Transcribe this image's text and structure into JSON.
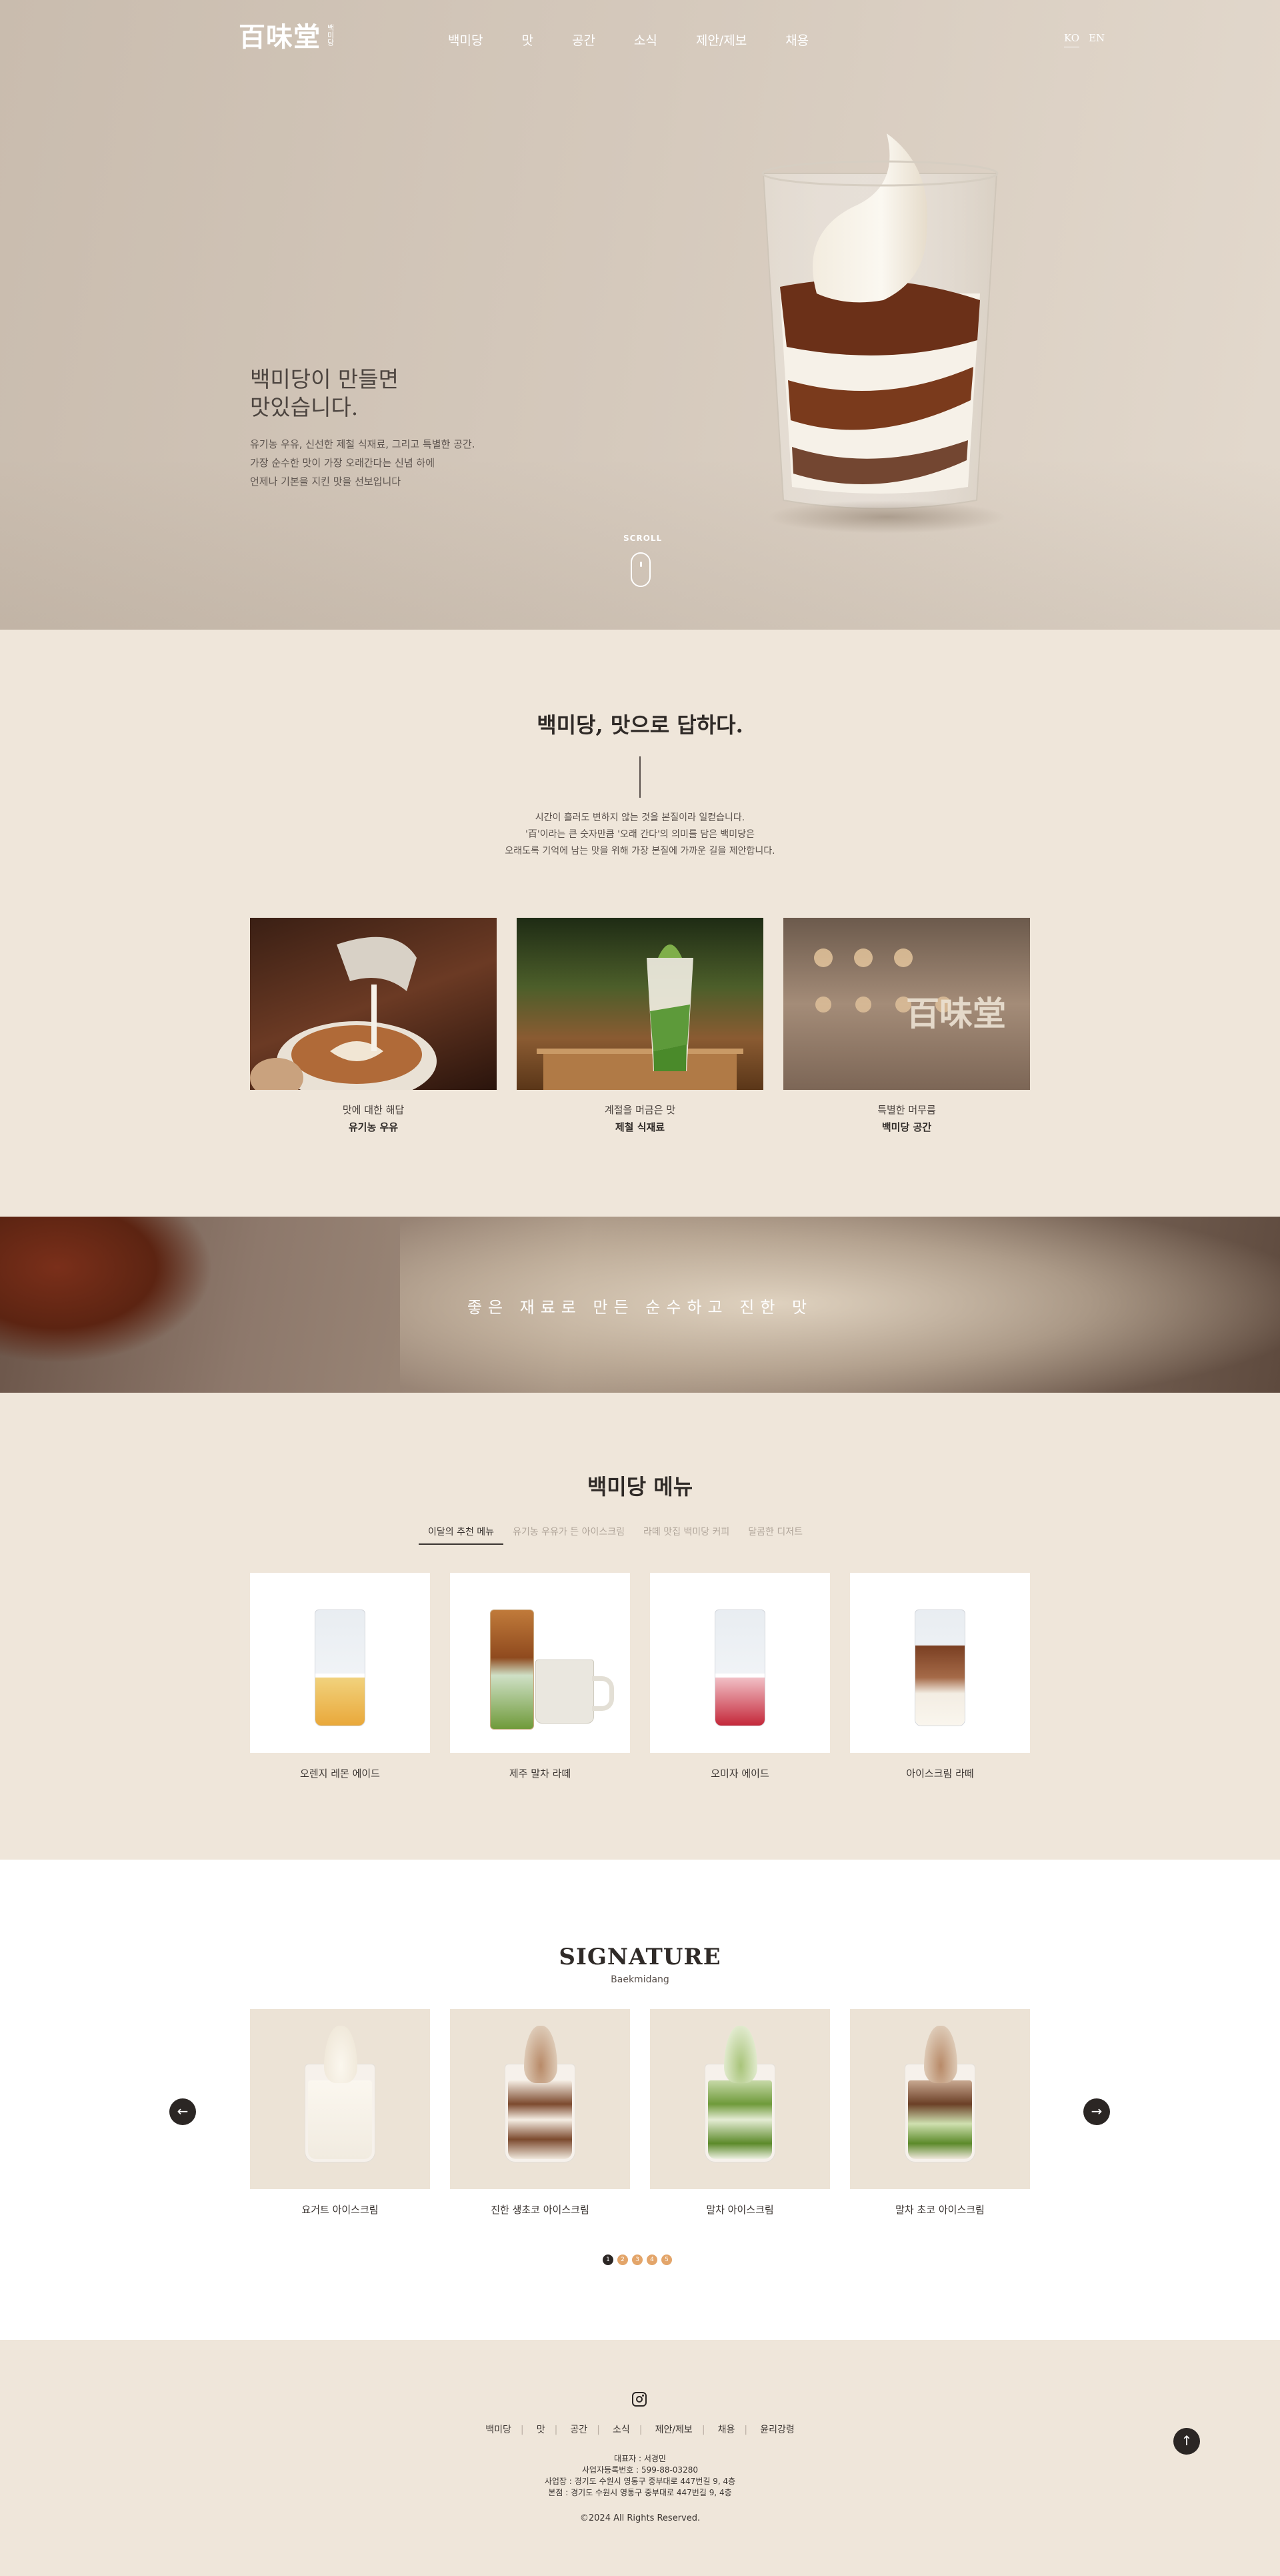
{
  "brand": {
    "logo_main": "百味堂",
    "logo_sub": "백미당"
  },
  "nav": {
    "items": [
      "백미당",
      "맛",
      "공간",
      "소식",
      "제안/제보",
      "채용"
    ],
    "languages": [
      "KO",
      "EN"
    ],
    "active_language": "KO"
  },
  "hero": {
    "title_line1": "백미당이 만들면",
    "title_line2": "맛있습니다.",
    "desc_lines": [
      "유기농 우유, 신선한 제철 식재료, 그리고 특별한 공간.",
      "가장 순수한 맛이 가장 오래간다는 신념 하에",
      "언제나 기본을 지킨 맛을 선보입니다"
    ],
    "scroll_label": "SCROLL"
  },
  "intro": {
    "title": "백미당, 맛으로 답하다.",
    "lines": [
      "시간이 흘러도 변하지 않는 것을 본질이라 일컫습니다.",
      "'百'이라는 큰 숫자만큼 '오래 간다'의 의미를 담은 백미당은",
      "오래도록 기억에 남는 맛을 위해 가장 본질에 가까운 길을 제안합니다."
    ],
    "features": [
      {
        "cap1": "맛에 대한 해답",
        "cap2": "유기농 우유"
      },
      {
        "cap1": "계절을 머금은 맛",
        "cap2": "제철 식재료"
      },
      {
        "cap1": "특별한 머무름",
        "cap2": "백미당 공간"
      }
    ],
    "feature3_sign": "百味堂"
  },
  "banner": {
    "text": "좋은 재료로 만든 순수하고 진한 맛"
  },
  "menu_section": {
    "title": "백미당 메뉴",
    "tabs": [
      "이달의 추천 메뉴",
      "유기농 우유가 든 아이스크림",
      "라떼 맛집 백미당 커피",
      "달콤한 디저트"
    ],
    "active_tab": 0,
    "items": [
      "오렌지 레몬 에이드",
      "제주 말차 라떼",
      "오미자 에이드",
      "아이스크림 라떼"
    ]
  },
  "signature": {
    "title": "SIGNATURE",
    "subtitle": "Baekmidang",
    "items": [
      "요거트 아이스크림",
      "진한 생초코 아이스크림",
      "말차 아이스크림",
      "말차 초코 아이스크림"
    ],
    "prev_icon": "arrow-left-icon",
    "next_icon": "arrow-right-icon",
    "pages": [
      "1",
      "2",
      "3",
      "4",
      "5"
    ],
    "active_page": 0
  },
  "footer": {
    "nav": [
      "백미당",
      "맛",
      "공간",
      "소식",
      "제안/제보",
      "채용",
      "윤리강령"
    ],
    "info_lines": [
      "대표자 : 서경민",
      "사업자등록번호 : 599-88-03280",
      "사업장 : 경기도 수원시 영통구 중부대로 447번길 9, 4층",
      "본점 : 경기도 수원시 영통구 중부대로 447번길 9, 4층"
    ],
    "copyright": "©2024 All Rights Reserved.",
    "instagram_icon": "instagram-icon",
    "top_button_icon": "arrow-up-icon"
  },
  "colors": {
    "hero_bg": "#d4c8bb",
    "page_bg": "#efe6da",
    "dark": "#2b2624",
    "accent_dot": "#e3a56a"
  }
}
